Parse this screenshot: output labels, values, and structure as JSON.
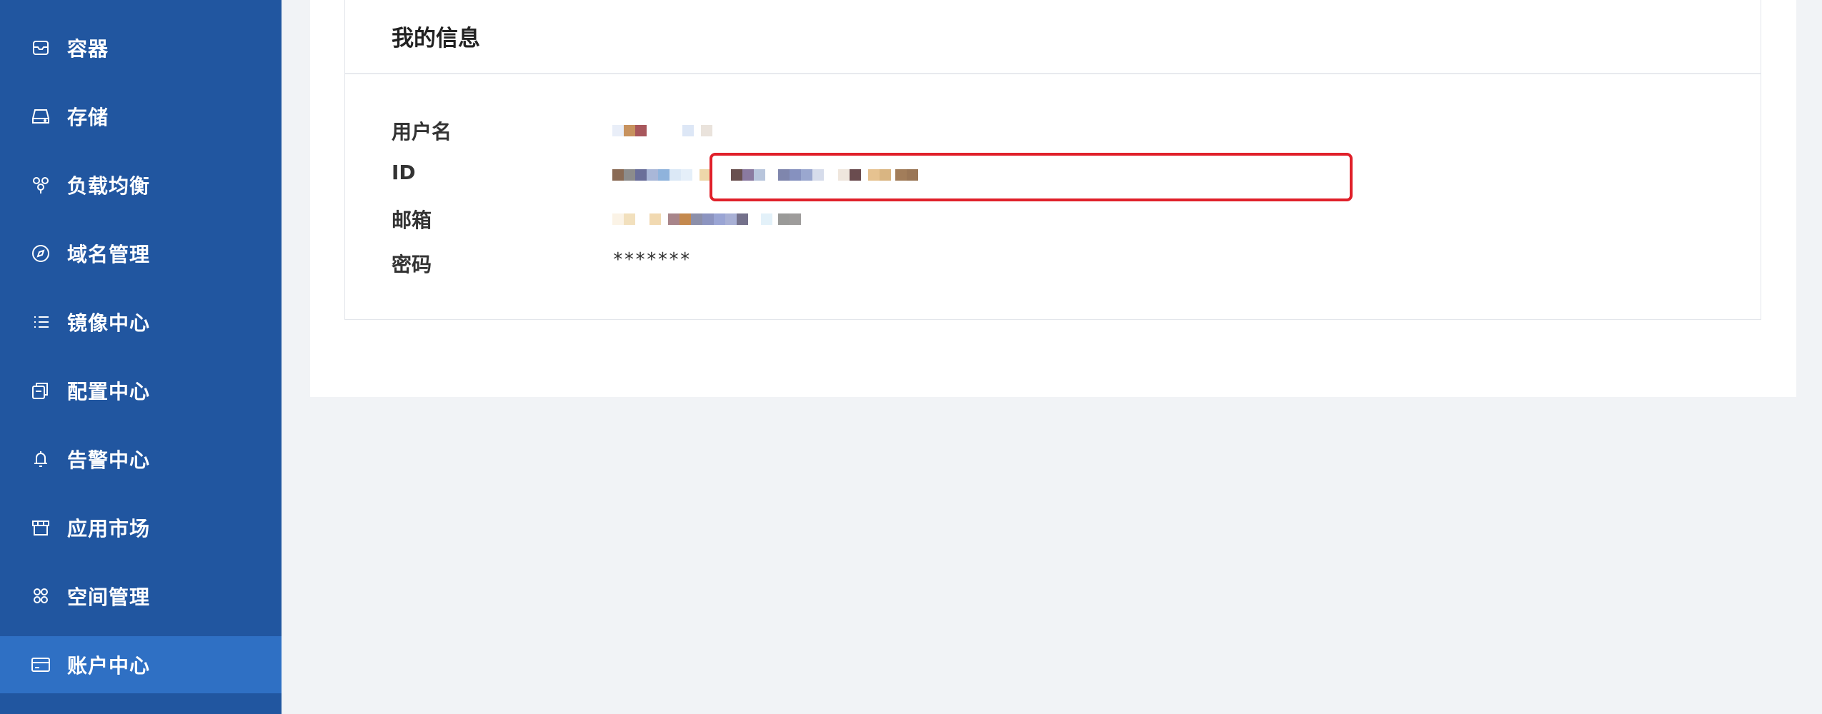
{
  "sidebar": {
    "items": [
      {
        "label": "容器",
        "icon": "container-icon"
      },
      {
        "label": "存储",
        "icon": "storage-icon"
      },
      {
        "label": "负载均衡",
        "icon": "load-balancer-icon"
      },
      {
        "label": "域名管理",
        "icon": "compass-icon"
      },
      {
        "label": "镜像中心",
        "icon": "list-icon"
      },
      {
        "label": "配置中心",
        "icon": "config-icon"
      },
      {
        "label": "告警中心",
        "icon": "bell-icon"
      },
      {
        "label": "应用市场",
        "icon": "store-icon"
      },
      {
        "label": "空间管理",
        "icon": "space-icon"
      },
      {
        "label": "账户中心",
        "icon": "card-icon",
        "active": true
      }
    ]
  },
  "account": {
    "title": "我的信息",
    "fields": {
      "username_label": "用户名",
      "id_label": "ID",
      "email_label": "邮箱",
      "password_label": "密码",
      "password_value": "*******"
    }
  },
  "colors": {
    "sidebar_bg": "#2156a0",
    "sidebar_active": "#2f70c4",
    "highlight_border": "#e0202a"
  }
}
